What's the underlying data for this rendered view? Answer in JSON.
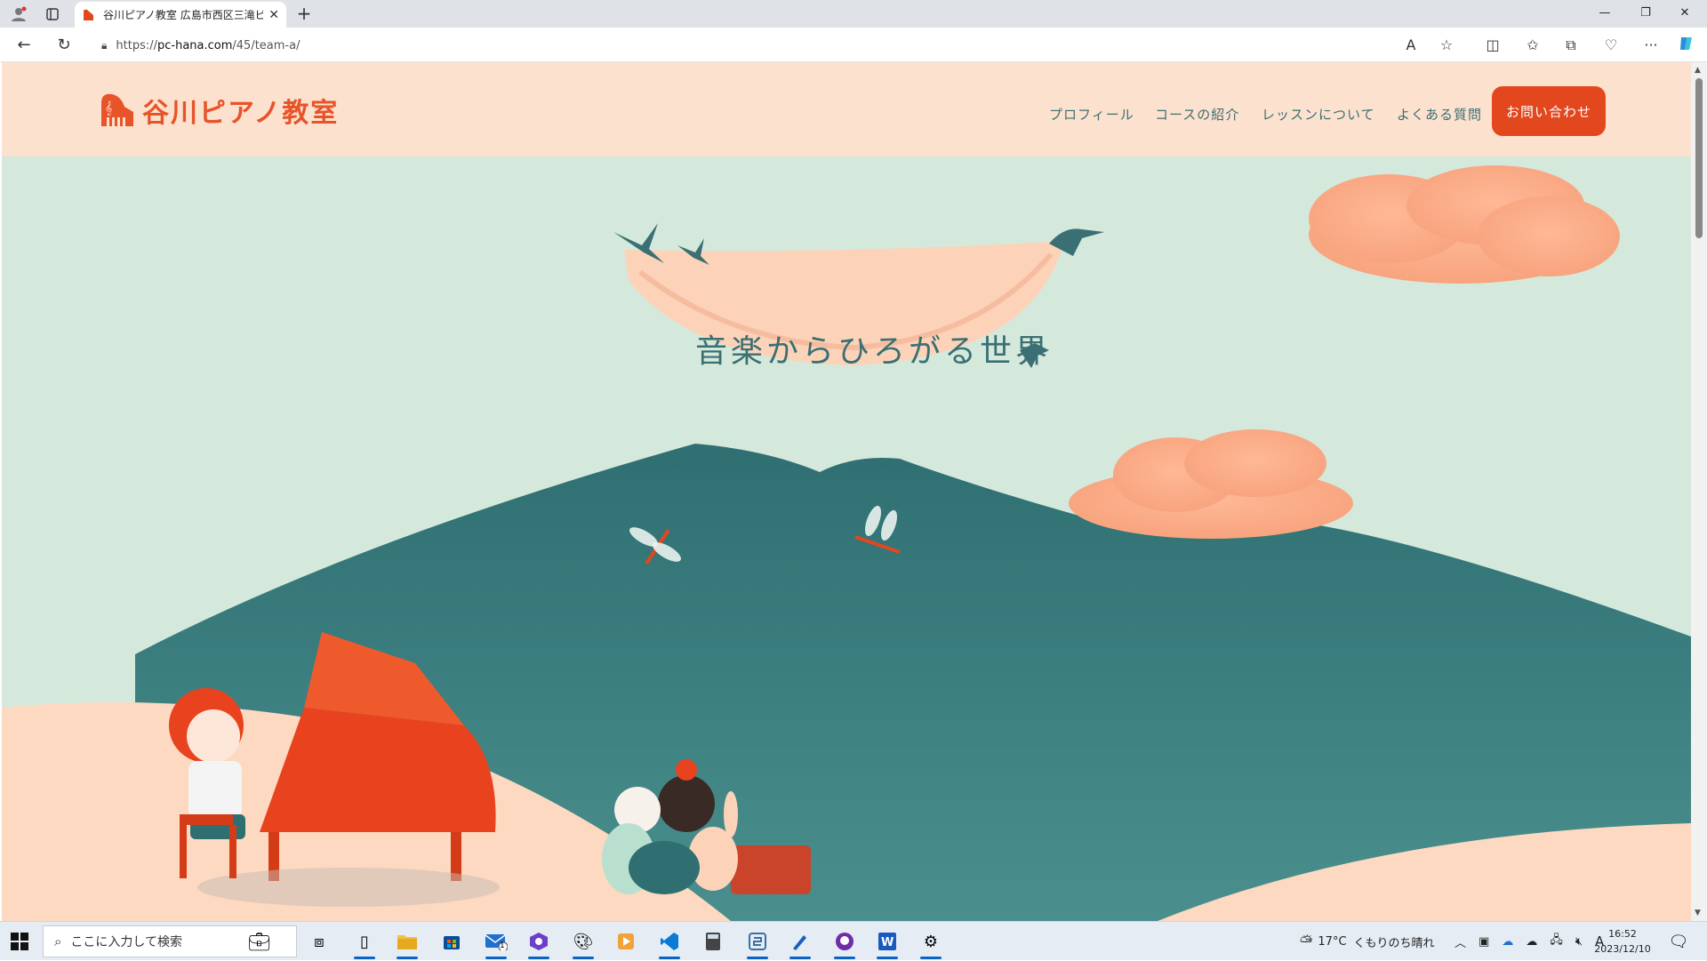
{
  "browser": {
    "tab_title": "谷川ピアノ教室 広島市西区三滝ピ",
    "url_prefix": "https://",
    "url_domain": "pc-hana.com",
    "url_path": "/45/team-a/"
  },
  "site": {
    "logo_text": "谷川ピアノ教室",
    "nav": [
      "プロフィール",
      "コースの紹介",
      "レッスンについて",
      "よくある質問"
    ],
    "cta_label": "お問い合わせ",
    "hero_title": "音楽からひろがる世界"
  },
  "taskbar": {
    "search_placeholder": "ここに入力して検索",
    "weather_temp": "17°C",
    "weather_desc": "くもりのち晴れ",
    "time": "16:52",
    "date": "2023/12/10",
    "mail_badge": "1",
    "ime_label": "A"
  },
  "colors": {
    "accent": "#e2471e",
    "teal": "#3a6f73",
    "header_bg": "#fde1cf",
    "sky": "#d4e9dc",
    "mountain": "#3c7b7e"
  }
}
